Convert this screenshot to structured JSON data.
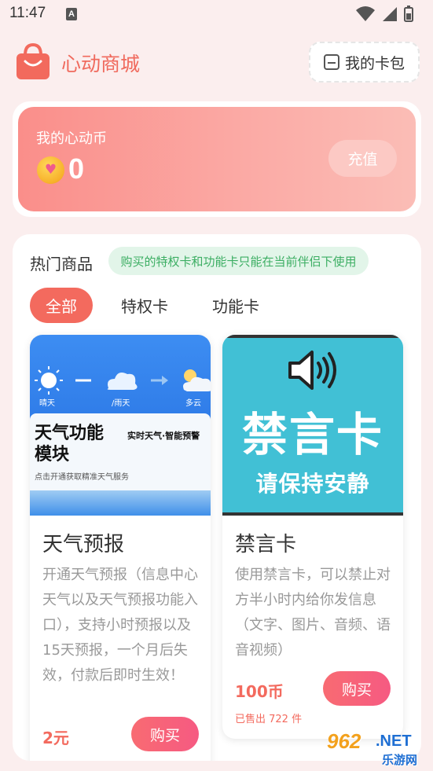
{
  "status_bar": {
    "time": "11:47",
    "notification_badge": "A"
  },
  "header": {
    "title": "心动商城",
    "wallet_label": "我的卡包"
  },
  "coins": {
    "label": "我的心动币",
    "value": "0",
    "recharge_label": "充值"
  },
  "products": {
    "section_title": "热门商品",
    "notice": "购买的特权卡和功能卡只能在当前伴侣下使用",
    "tabs": [
      {
        "label": "全部",
        "active": true
      },
      {
        "label": "特权卡",
        "active": false
      },
      {
        "label": "功能卡",
        "active": false
      }
    ],
    "items": [
      {
        "title": "天气预报",
        "description": "开通天气预报（信息中心天气以及天气预报功能入口），支持小时预报以及15天预报，一个月后失效，付款后即时生效！",
        "price": "2元",
        "buy_label": "购买",
        "image": {
          "captions": [
            "晴天",
            "/雨天",
            "多云"
          ],
          "headline": "天气功能\n模块",
          "side_text": "实时天气·智能预警",
          "subtext": "点击开通获取精准天气服务"
        }
      },
      {
        "title": "禁言卡",
        "description": "使用禁言卡，可以禁止对方半小时内给你发信息（文字、图片、音频、语音视频）",
        "price": "100币",
        "buy_label": "购买",
        "sold": "已售出 722 件",
        "image": {
          "headline": "禁言卡",
          "subtext": "请保持安静"
        }
      }
    ]
  },
  "watermark": {
    "number": "962",
    "suffix": ".NET",
    "sub": "乐游网"
  },
  "colors": {
    "accent": "#f36a5e",
    "title": "#f06a5d",
    "notice_green": "#3cae63",
    "coin_card": "#fa8e8a"
  }
}
